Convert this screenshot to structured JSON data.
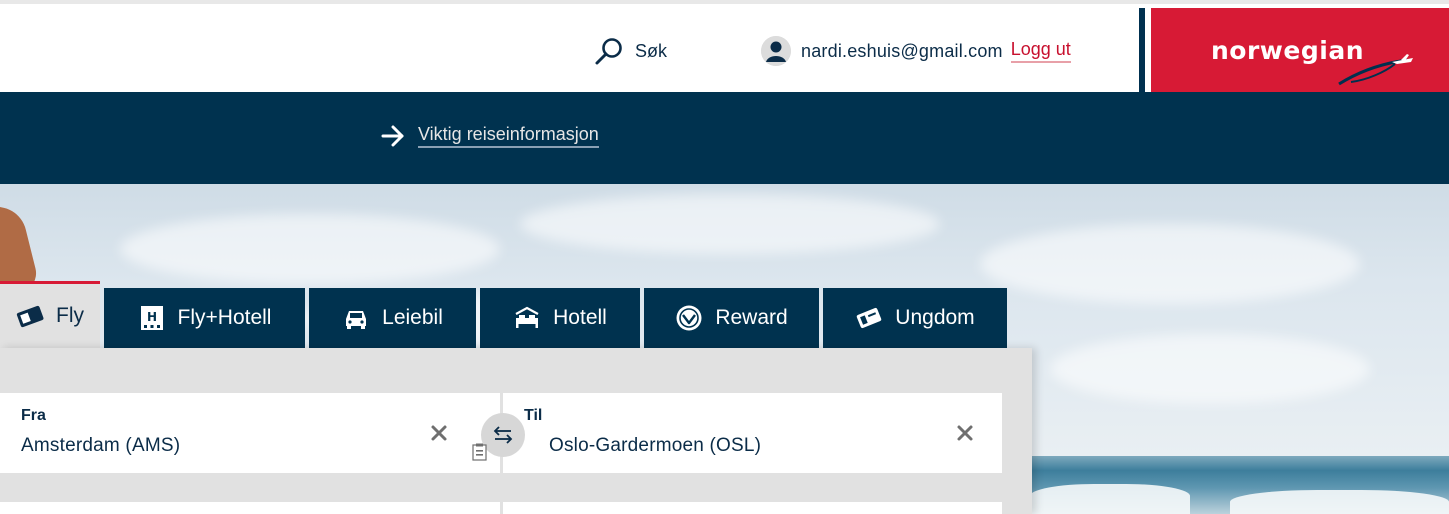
{
  "header": {
    "search_label": "Søk",
    "user_email": "nardi.eshuis@gmail.com",
    "logout_label": "Logg ut",
    "brand": "norwegian"
  },
  "notice": {
    "travel_info_label": "Viktig reiseinformasjon"
  },
  "tabs": [
    {
      "label": "Fly",
      "icon": "ticket-icon",
      "active": true
    },
    {
      "label": "Fly+Hotell",
      "icon": "hotel-building-icon",
      "active": false
    },
    {
      "label": "Leiebil",
      "icon": "car-icon",
      "active": false
    },
    {
      "label": "Hotell",
      "icon": "bed-icon",
      "active": false
    },
    {
      "label": "Reward",
      "icon": "reward-badge-icon",
      "active": false
    },
    {
      "label": "Ungdom",
      "icon": "youth-ticket-icon",
      "active": false
    }
  ],
  "search_form": {
    "from": {
      "label": "Fra",
      "value": "Amsterdam (AMS)"
    },
    "to": {
      "label": "Til",
      "value": "Oslo-Gardermoen (OSL)"
    }
  },
  "colors": {
    "brand_red": "#d71a35",
    "navy": "#00324f",
    "panel_gray": "#e1e1e1"
  }
}
